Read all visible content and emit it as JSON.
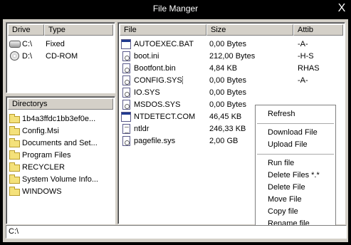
{
  "window": {
    "title": "File Manger",
    "close_glyph": "X"
  },
  "drives": {
    "headers": [
      "Drive",
      "Type"
    ],
    "items": [
      {
        "name": "C:\\",
        "type": "Fixed",
        "icon": "hard-drive-icon"
      },
      {
        "name": "D:\\",
        "type": "CD-ROM",
        "icon": "cdrom-icon"
      }
    ]
  },
  "directories": {
    "header": "Directorys",
    "items": [
      "1b4a3ffdc1bb3ef0e...",
      "Config.Msi",
      "Documents and Set...",
      "Program Files",
      "RECYCLER",
      "System Volume Info...",
      "WINDOWS"
    ]
  },
  "files": {
    "headers": [
      "File",
      "Size",
      "Attib"
    ],
    "items": [
      {
        "name": "AUTOEXEC.BAT",
        "size": "0,00 Bytes",
        "attr": "-A-",
        "icon": "batch-file-icon"
      },
      {
        "name": "boot.ini",
        "size": "212,00 Bytes",
        "attr": "-H-S",
        "icon": "config-file-icon"
      },
      {
        "name": "Bootfont.bin",
        "size": "4,84 KB",
        "attr": "RHAS",
        "icon": "config-file-icon"
      },
      {
        "name": "CONFIG.SYS",
        "size": "0,00 Bytes",
        "attr": "-A-",
        "icon": "config-file-icon"
      },
      {
        "name": "IO.SYS",
        "size": "0,00 Bytes",
        "attr": "",
        "icon": "config-file-icon"
      },
      {
        "name": "MSDOS.SYS",
        "size": "0,00 Bytes",
        "attr": "",
        "icon": "config-file-icon"
      },
      {
        "name": "NTDETECT.COM",
        "size": "46,45 KB",
        "attr": "",
        "icon": "application-icon"
      },
      {
        "name": "ntldr",
        "size": "246,33 KB",
        "attr": "",
        "icon": "text-file-icon"
      },
      {
        "name": "pagefile.sys",
        "size": "2,00 GB",
        "attr": "",
        "icon": "config-file-icon"
      }
    ]
  },
  "context_menu": {
    "groups": [
      [
        "Refresh"
      ],
      [
        "Download File",
        "Upload File"
      ],
      [
        "Run file",
        "Delete Files *.*",
        "Delete File",
        "Move File",
        "Copy file",
        "Rename file"
      ]
    ]
  },
  "status": {
    "path": "C:\\"
  }
}
